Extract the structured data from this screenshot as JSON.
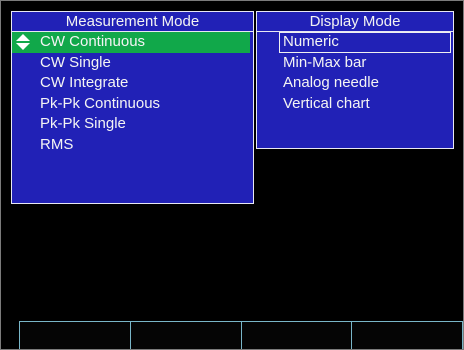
{
  "measurement_mode": {
    "title": "Measurement Mode",
    "items": [
      "CW Continuous",
      "CW Single",
      "CW Integrate",
      "Pk-Pk Continuous",
      "Pk-Pk Single",
      "RMS"
    ],
    "selected_index": 0
  },
  "display_mode": {
    "title": "Display Mode",
    "items": [
      "Numeric",
      "Min-Max bar",
      "Analog needle",
      "Vertical chart"
    ],
    "selected_index": 0
  },
  "colors": {
    "panel_bg": "#2121b6",
    "selection_green": "#11a84a",
    "screen_bg": "#000000",
    "softkey_border": "#79b6c8"
  },
  "icons": {
    "selector": "up-down-arrows-icon"
  },
  "softkeys": [
    "",
    "",
    "",
    ""
  ]
}
